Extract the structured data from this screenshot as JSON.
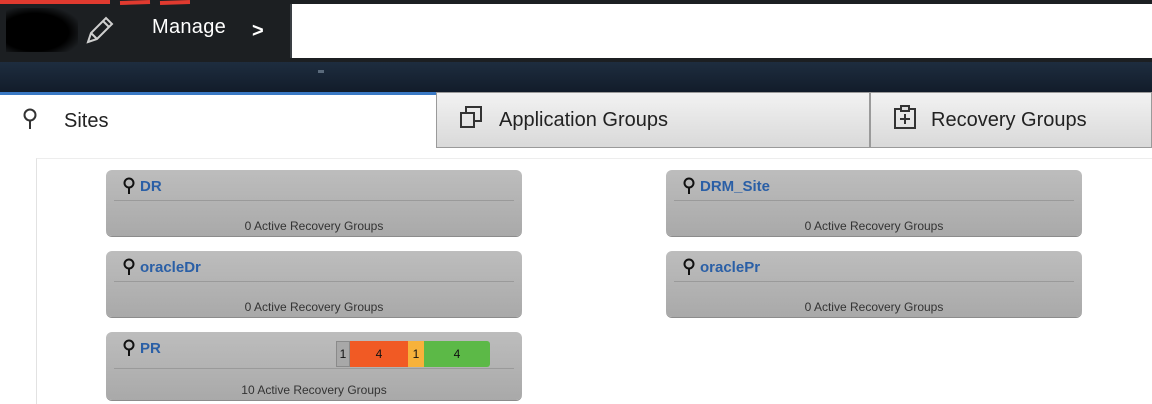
{
  "header": {
    "breadcrumb_label": "Manage",
    "breadcrumb_separator": ">",
    "search_value": ""
  },
  "tabs": [
    {
      "label": "Sites",
      "icon": "map-pin-icon",
      "active": true
    },
    {
      "label": "Application Groups",
      "icon": "copy-icon",
      "active": false
    },
    {
      "label": "Recovery Groups",
      "icon": "clipboard-plus-icon",
      "active": false
    }
  ],
  "sites": [
    {
      "name": "DR",
      "status": "0 Active Recovery Groups"
    },
    {
      "name": "DRM_Site",
      "status": "0 Active Recovery Groups"
    },
    {
      "name": "oracleDr",
      "status": "0 Active Recovery Groups"
    },
    {
      "name": "oraclePr",
      "status": "0 Active Recovery Groups"
    },
    {
      "name": "PR",
      "status": "10 Active Recovery Groups",
      "counts": {
        "gray": "1",
        "red": "4",
        "yellow": "1",
        "green": "4"
      }
    }
  ],
  "colors": {
    "active_tab_accent": "#3a79c4",
    "site_name": "#2a5fa6",
    "status_red": "#f15a24",
    "status_yellow": "#f7b23b",
    "status_green": "#5cb947",
    "status_gray": "#a8a8a8"
  }
}
